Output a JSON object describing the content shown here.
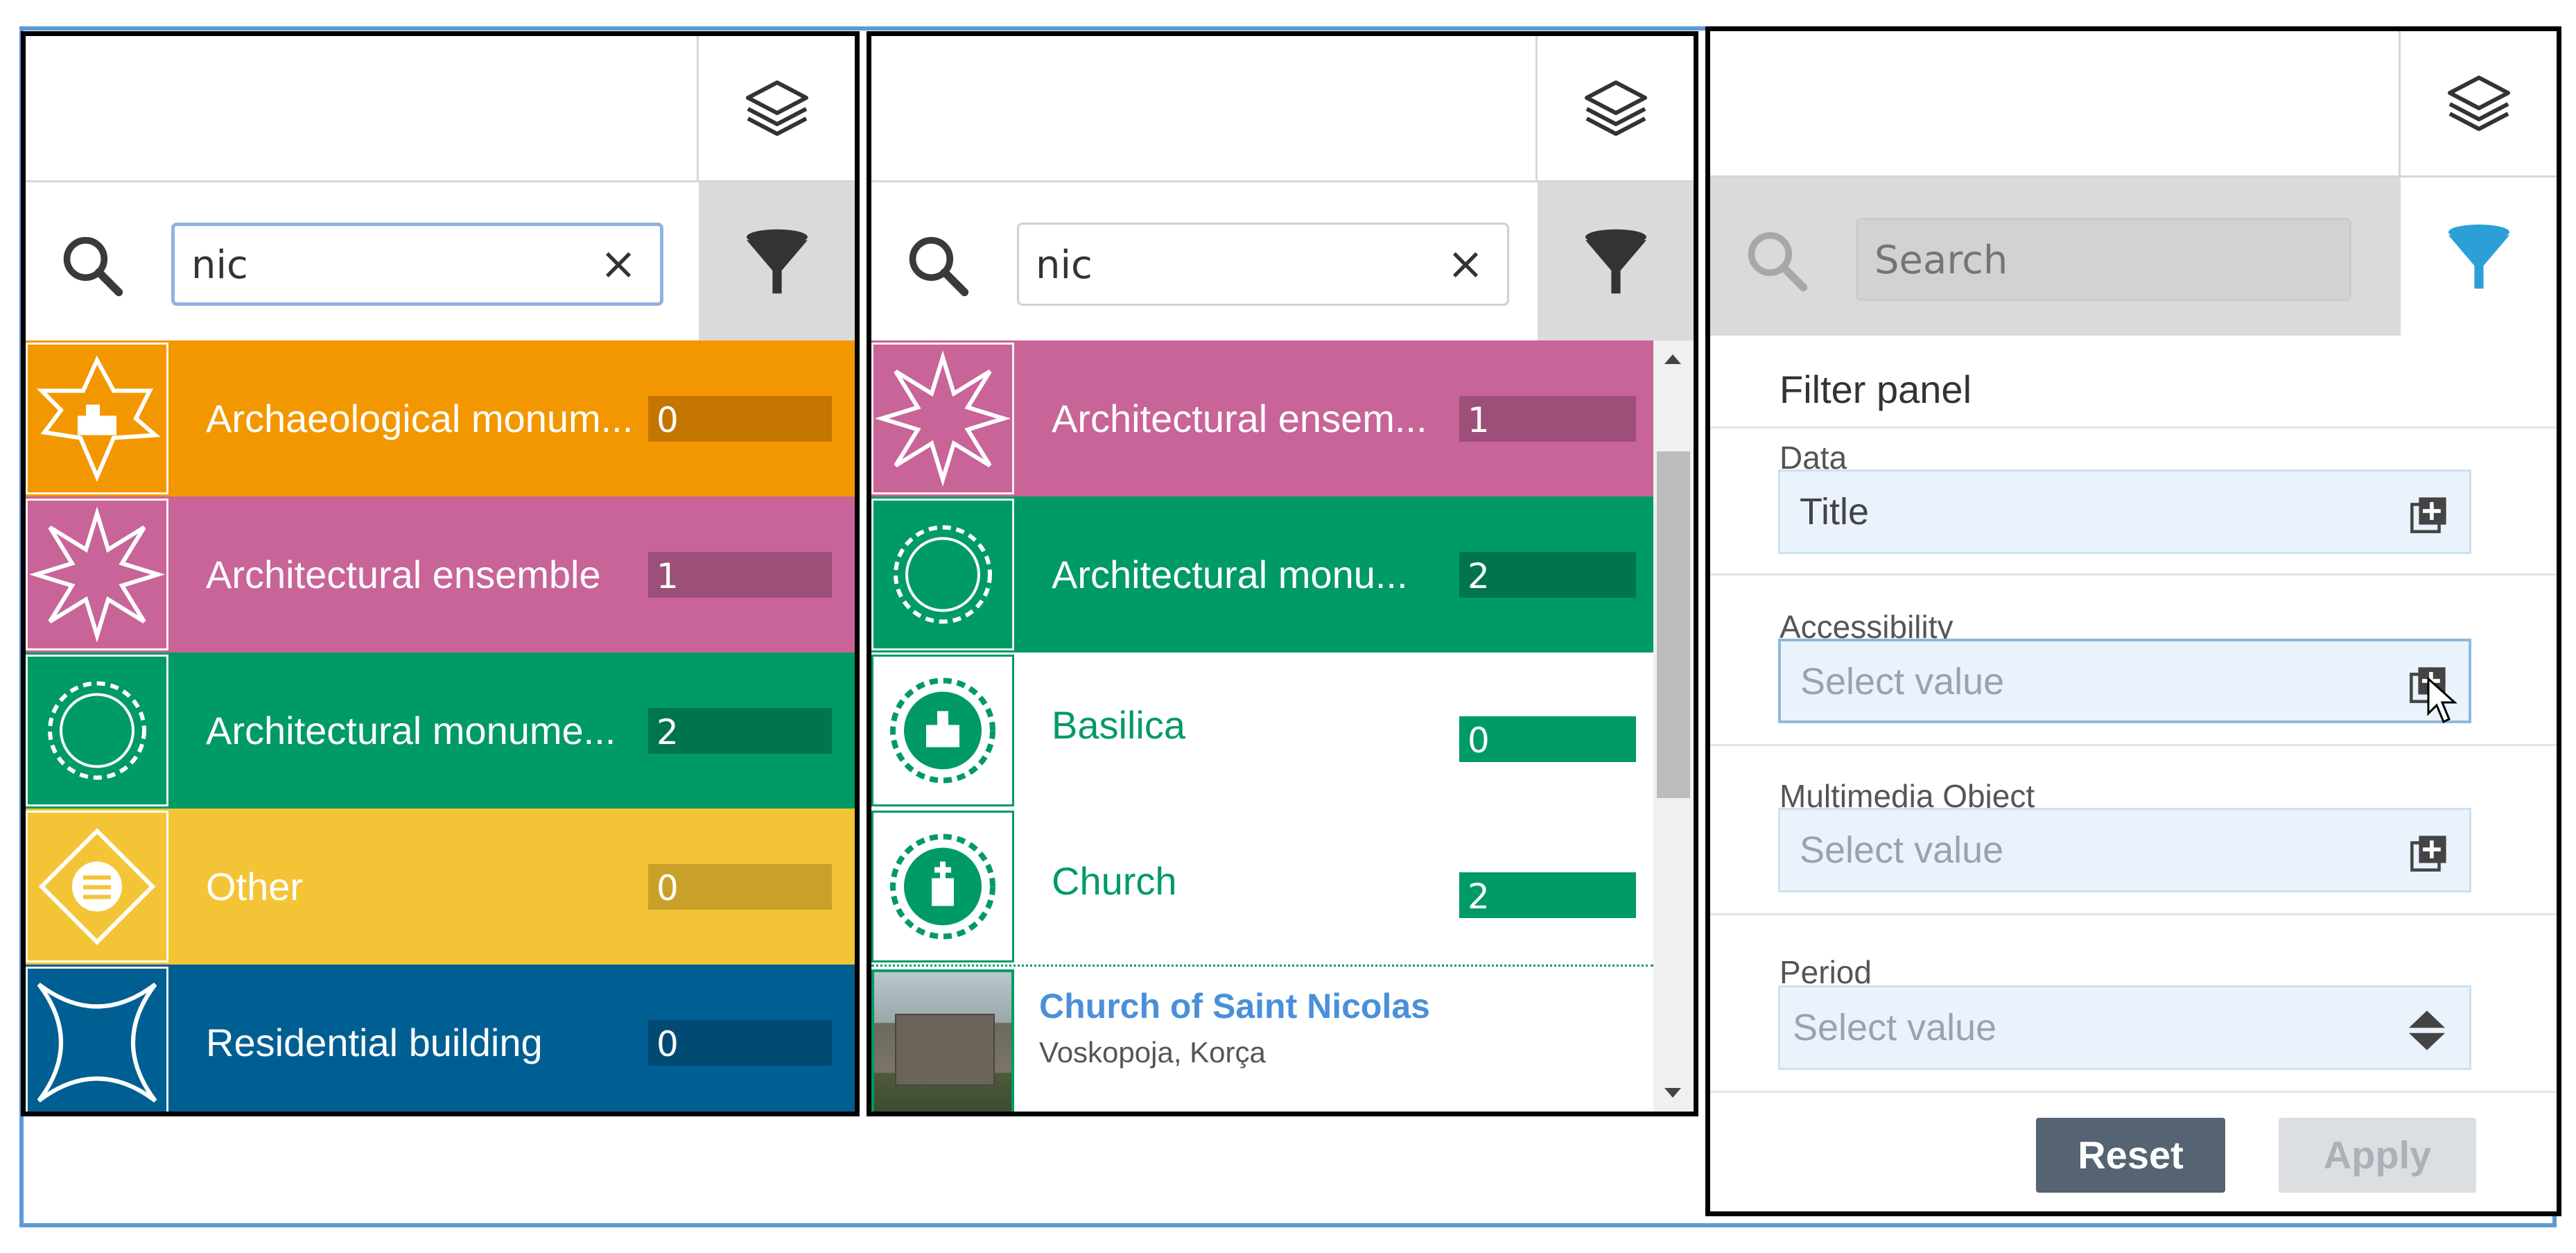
{
  "colors": {
    "archaeological": "#f39700",
    "architectural_ensemble": "#c86498",
    "architectural_monument": "#009a65",
    "other": "#f3c536",
    "residential": "#005f92",
    "link_blue": "#4a90d9",
    "filter_blue": "#2d9fd8"
  },
  "panel1": {
    "search": {
      "value": "nic",
      "clear_icon": "×"
    },
    "categories": [
      {
        "label": "Archaeological monum...",
        "count": "0",
        "icon": "archaeological-site-icon"
      },
      {
        "label": "Architectural ensemble",
        "count": "1",
        "icon": "star-icon"
      },
      {
        "label": "Architectural monume...",
        "count": "2",
        "icon": "sunburst-icon"
      },
      {
        "label": "Other",
        "count": "0",
        "icon": "other-diamond-icon"
      },
      {
        "label": "Residential building",
        "count": "0",
        "icon": "four-point-star-icon"
      }
    ]
  },
  "panel2": {
    "search": {
      "value": "nic",
      "clear_icon": "×"
    },
    "categories": [
      {
        "label": "Architectural ensem...",
        "count": "1",
        "icon": "star-icon"
      },
      {
        "label": "Architectural monu...",
        "count": "2",
        "icon": "sunburst-icon"
      },
      {
        "label": "Basilica",
        "count": "0",
        "icon": "basilica-icon"
      },
      {
        "label": "Church",
        "count": "2",
        "icon": "church-icon"
      }
    ],
    "result": {
      "title": "Church of Saint Nicolas",
      "subtitle": "Voskopoja, Korça",
      "thumbnail": "church-photo"
    }
  },
  "panel3": {
    "search": {
      "placeholder": "Search"
    },
    "title": "Filter panel",
    "fields": [
      {
        "label": "Data",
        "value": "Title",
        "icon": "add-box-icon"
      },
      {
        "label": "Accessibility",
        "value": "Select value",
        "icon": "add-box-icon"
      },
      {
        "label": "Multimedia Object",
        "value": "Select value",
        "icon": "add-box-icon"
      },
      {
        "label": "Period",
        "value": "Select value",
        "icon": "sort-arrows-icon"
      }
    ],
    "buttons": {
      "reset": "Reset",
      "apply": "Apply"
    }
  }
}
